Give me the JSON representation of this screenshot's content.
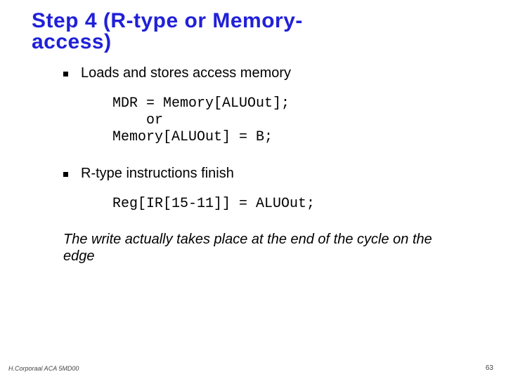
{
  "title_line1": "Step 4 (R-type or Memory-",
  "title_line2": "access)",
  "bullets": [
    {
      "text": "Loads and stores access memory"
    },
    {
      "text": "R-type instructions finish"
    }
  ],
  "code1": "MDR = Memory[ALUOut];\n    or\nMemory[ALUOut] = B;",
  "code2": "Reg[IR[15-11]] = ALUOut;",
  "note": "The write actually takes place at the end of the cycle on the edge",
  "footer_left": "H.Corporaal  ACA 5MD00",
  "footer_right": "63"
}
